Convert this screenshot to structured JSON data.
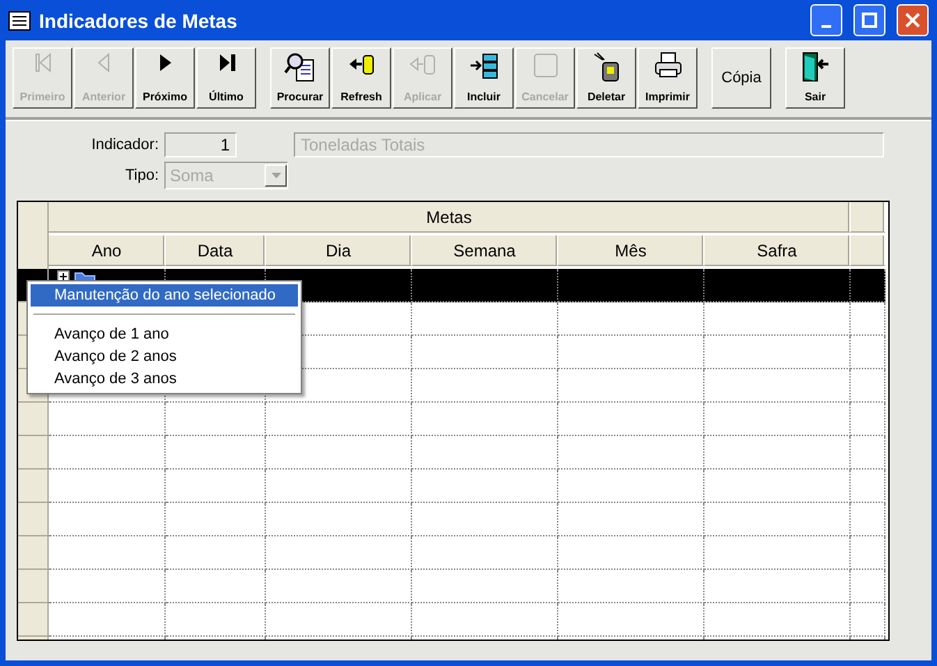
{
  "window": {
    "title": "Indicadores de Metas"
  },
  "toolbar_groups": [
    [
      {
        "kind": "first",
        "label": "Primeiro",
        "disabled": true
      },
      {
        "kind": "prev",
        "label": "Anterior",
        "disabled": true
      },
      {
        "kind": "next",
        "label": "Próximo",
        "disabled": false
      },
      {
        "kind": "last",
        "label": "Último",
        "disabled": false
      }
    ],
    [
      {
        "kind": "search",
        "label": "Procurar",
        "disabled": false
      },
      {
        "kind": "refresh",
        "label": "Refresh",
        "disabled": false
      },
      {
        "kind": "apply",
        "label": "Aplicar",
        "disabled": true
      },
      {
        "kind": "insert",
        "label": "Incluir",
        "disabled": false
      },
      {
        "kind": "cancel",
        "label": "Cancelar",
        "disabled": true
      },
      {
        "kind": "delete",
        "label": "Deletar",
        "disabled": false
      },
      {
        "kind": "print",
        "label": "Imprimir",
        "disabled": false
      }
    ],
    [
      {
        "kind": "text",
        "label": "Cópia",
        "disabled": false
      }
    ],
    [
      {
        "kind": "exit",
        "label": "Sair",
        "disabled": false
      }
    ]
  ],
  "form": {
    "indicador_label": "Indicador:",
    "indicador_code": "1",
    "indicador_name": "Toneladas Totais",
    "tipo_label": "Tipo:",
    "tipo_value": "Soma",
    "tipo_disabled": true
  },
  "grid": {
    "group_header": "Metas",
    "columns": [
      "Ano",
      "Data",
      "Dia",
      "Semana",
      "Mês",
      "Safra"
    ],
    "rows": [
      {
        "kind": "group",
        "selected": true
      },
      {
        "kind": "empty",
        "selected": false
      },
      {
        "kind": "empty",
        "selected": false
      },
      {
        "kind": "empty",
        "selected": false
      },
      {
        "kind": "empty",
        "selected": false
      },
      {
        "kind": "empty",
        "selected": false
      },
      {
        "kind": "empty",
        "selected": false
      },
      {
        "kind": "empty",
        "selected": false
      },
      {
        "kind": "empty",
        "selected": false
      },
      {
        "kind": "empty",
        "selected": false
      },
      {
        "kind": "empty",
        "selected": false
      },
      {
        "kind": "empty",
        "selected": false
      }
    ]
  },
  "context_menu": [
    {
      "kind": "item",
      "label": "Manutenção do ano selecionado",
      "selected": true
    },
    {
      "kind": "separator"
    },
    {
      "kind": "item",
      "label": "Avanço de 1 ano",
      "selected": false
    },
    {
      "kind": "item",
      "label": "Avanço de 2 anos",
      "selected": false
    },
    {
      "kind": "item",
      "label": "Avanço de 3 anos",
      "selected": false
    }
  ]
}
